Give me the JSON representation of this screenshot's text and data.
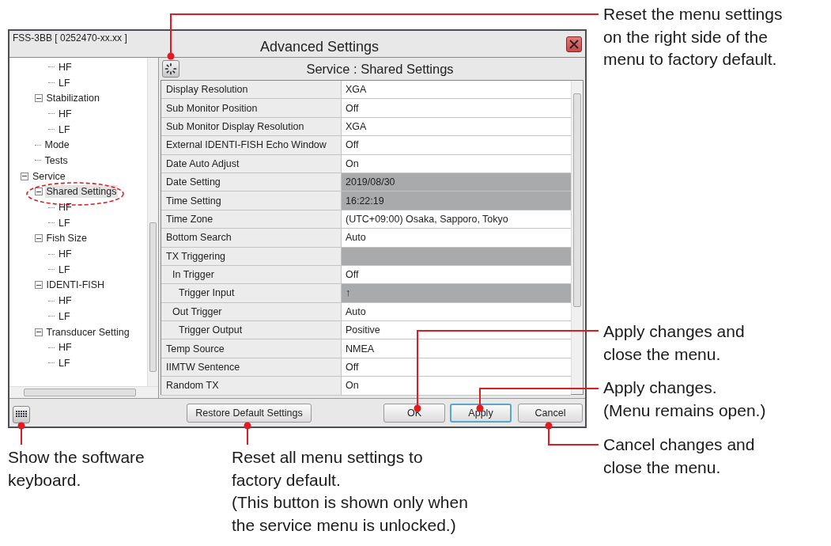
{
  "window": {
    "device_label": "FSS-3BB [ 0252470-xx.xx ]",
    "title": "Advanced Settings"
  },
  "tree": [
    {
      "children": [
        {
          "children": [
            {
              "label": "HF",
              "selected": false
            },
            {
              "label": "LF",
              "selected": false
            }
          ]
        },
        {
          "label": "Stabilization",
          "selected": false,
          "expanded": true,
          "children": [
            {
              "label": "HF",
              "selected": false
            },
            {
              "label": "LF",
              "selected": false
            }
          ]
        },
        {
          "label": "Mode",
          "selected": false
        },
        {
          "label": "Tests",
          "selected": false
        }
      ]
    },
    {
      "label": "Service",
      "selected": false,
      "expanded": true,
      "children": [
        {
          "label": "Shared Settings",
          "selected": true,
          "expanded": true,
          "children": [
            {
              "label": "HF",
              "selected": false
            },
            {
              "label": "LF",
              "selected": false
            }
          ]
        },
        {
          "label": "Fish Size",
          "selected": false,
          "expanded": true,
          "children": [
            {
              "label": "HF",
              "selected": false
            },
            {
              "label": "LF",
              "selected": false
            }
          ]
        },
        {
          "label": "IDENTI-FISH",
          "selected": false,
          "expanded": true,
          "children": [
            {
              "label": "HF",
              "selected": false
            },
            {
              "label": "LF",
              "selected": false
            }
          ]
        },
        {
          "label": "Transducer Setting",
          "selected": false,
          "expanded": true,
          "children": [
            {
              "label": "HF",
              "selected": false
            },
            {
              "label": "LF",
              "selected": false
            }
          ]
        }
      ]
    }
  ],
  "panel": {
    "title": "Service : Shared Settings"
  },
  "settings": [
    {
      "label": "Display Resolution",
      "value": "XGA",
      "disabled": false
    },
    {
      "label": "Sub Monitor Position",
      "value": "Off",
      "disabled": false
    },
    {
      "label": "Sub Monitor Display Resolution",
      "value": "XGA",
      "disabled": false
    },
    {
      "label": "External IDENTI-FISH Echo Window",
      "value": "Off",
      "disabled": false
    },
    {
      "label": "Date Auto Adjust",
      "value": "On",
      "disabled": false
    },
    {
      "label": "Date Setting",
      "value": "2019/08/30",
      "disabled": true
    },
    {
      "label": "Time Setting",
      "value": "16:22:19",
      "disabled": true
    },
    {
      "label": "Time Zone",
      "value": "(UTC+09:00) Osaka, Sapporo, Tokyo",
      "disabled": false
    },
    {
      "label": "Bottom Search",
      "value": "Auto",
      "disabled": false
    },
    {
      "label": "TX Triggering",
      "disabled": true,
      "children": [
        {
          "label": "In Trigger",
          "value": "Off",
          "disabled": false,
          "children": [
            {
              "label": "Trigger Input",
              "value": "↑",
              "disabled": true
            }
          ]
        },
        {
          "label": "Out Trigger",
          "value": "Auto",
          "disabled": false,
          "children": [
            {
              "label": "Trigger Output",
              "value": "Positive",
              "disabled": false
            }
          ]
        }
      ]
    },
    {
      "label": "Temp Source",
      "value": "NMEA",
      "disabled": false
    },
    {
      "label": "IIMTW Sentence",
      "value": "Off",
      "disabled": false
    },
    {
      "label": "Random TX",
      "value": "On",
      "disabled": false
    }
  ],
  "buttons": [
    {
      "label": "Restore Default Settings",
      "selected": false
    },
    {
      "label": "OK",
      "selected": false
    },
    {
      "label": "Apply",
      "selected": true
    },
    {
      "label": "Cancel",
      "selected": false
    }
  ],
  "callouts": [
    {
      "text": "Reset the menu settings\non the right side of the\nmenu to factory default."
    },
    {
      "text": "Apply changes and\nclose the menu."
    },
    {
      "text": "Apply changes.\n(Menu remains open.)"
    },
    {
      "text": "Cancel changes and\nclose the menu."
    },
    {
      "text": "Show the software\nkeyboard."
    },
    {
      "text": "Reset all menu settings to\nfactory default.\n(This button is shown only when\nthe service menu is unlocked.)"
    }
  ]
}
